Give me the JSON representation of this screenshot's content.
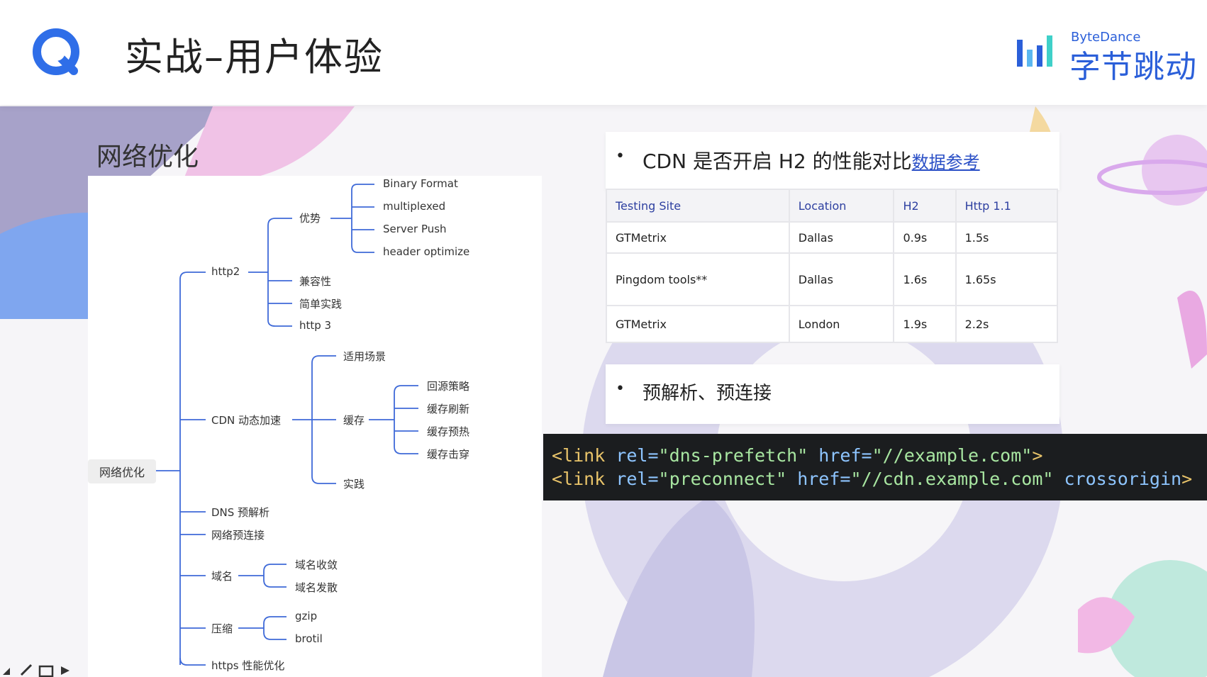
{
  "header": {
    "title": "实战–用户体验"
  },
  "brand": {
    "name_en": "ByteDance",
    "name_cn": "字节跳动"
  },
  "left_panel": {
    "heading": "网络优化",
    "root": "网络优化",
    "nodes": {
      "http2": "http2",
      "advantage": "优势",
      "binary_format": "Binary Format",
      "multiplexed": "multiplexed",
      "server_push": "Server Push",
      "header_optimize": "header optimize",
      "compat": "兼容性",
      "simple_practice": "简单实践",
      "http3": "http 3",
      "cdn": "CDN 动态加速",
      "scenario": "适用场景",
      "cache": "缓存",
      "back_to_origin": "回源策略",
      "cache_refresh": "缓存刷新",
      "cache_warm": "缓存预热",
      "cache_penetrate": "缓存击穿",
      "practice": "实践",
      "dns": "DNS 预解析",
      "preconnect": "网络预连接",
      "domain": "域名",
      "domain_converge": "域名收敛",
      "domain_shard": "域名发散",
      "compress": "压缩",
      "gzip": "gzip",
      "brotli": "brotil",
      "https": "https 性能优化"
    }
  },
  "right_panel": {
    "bullet1_text": "CDN 是否开启 H2 的性能对比",
    "bullet1_link": "数据参考",
    "table": {
      "headers": [
        "Testing Site",
        "Location",
        "H2",
        "Http 1.1"
      ],
      "rows": [
        [
          "GTMetrix",
          "Dallas",
          "0.9s",
          "1.5s"
        ],
        [
          "Pingdom tools**",
          "Dallas",
          "1.6s",
          "1.65s"
        ],
        [
          "GTMetrix",
          "London",
          "1.9s",
          "2.2s"
        ]
      ]
    },
    "bullet2_text": "预解析、预连接"
  },
  "code": {
    "line1": {
      "tag": "<link",
      "attr1": " rel=",
      "val1": "\"dns-prefetch\"",
      "attr2": " href=",
      "val2": "\"//example.com\"",
      "end": ">"
    },
    "line2": {
      "tag": "<link",
      "attr1": " rel=",
      "val1": "\"preconnect\"",
      "attr2": " href=",
      "val2": "\"//cdn.example.com\"",
      "attr3": " crossorigin",
      "end": ">"
    }
  },
  "colors": {
    "brand_blue": "#2b5fd9",
    "tree_line": "#3f6ad8",
    "table_header_text": "#2d3fa0",
    "code_bg": "#1b1d1f"
  }
}
